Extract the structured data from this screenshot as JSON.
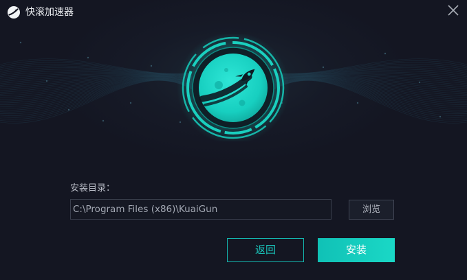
{
  "window": {
    "title": "快滚加速器",
    "logo_icon": "rocket-logo-icon",
    "close_icon": "close-icon"
  },
  "hero": {
    "icon": "rocket-planet-icon"
  },
  "install": {
    "dir_label": "安装目录：",
    "path_value": "C:\\Program Files (x86)\\KuaiGun",
    "browse_label": "浏览",
    "back_label": "返回",
    "install_label": "安装"
  },
  "colors": {
    "accent": "#1ad8c6",
    "background": "#141622"
  }
}
